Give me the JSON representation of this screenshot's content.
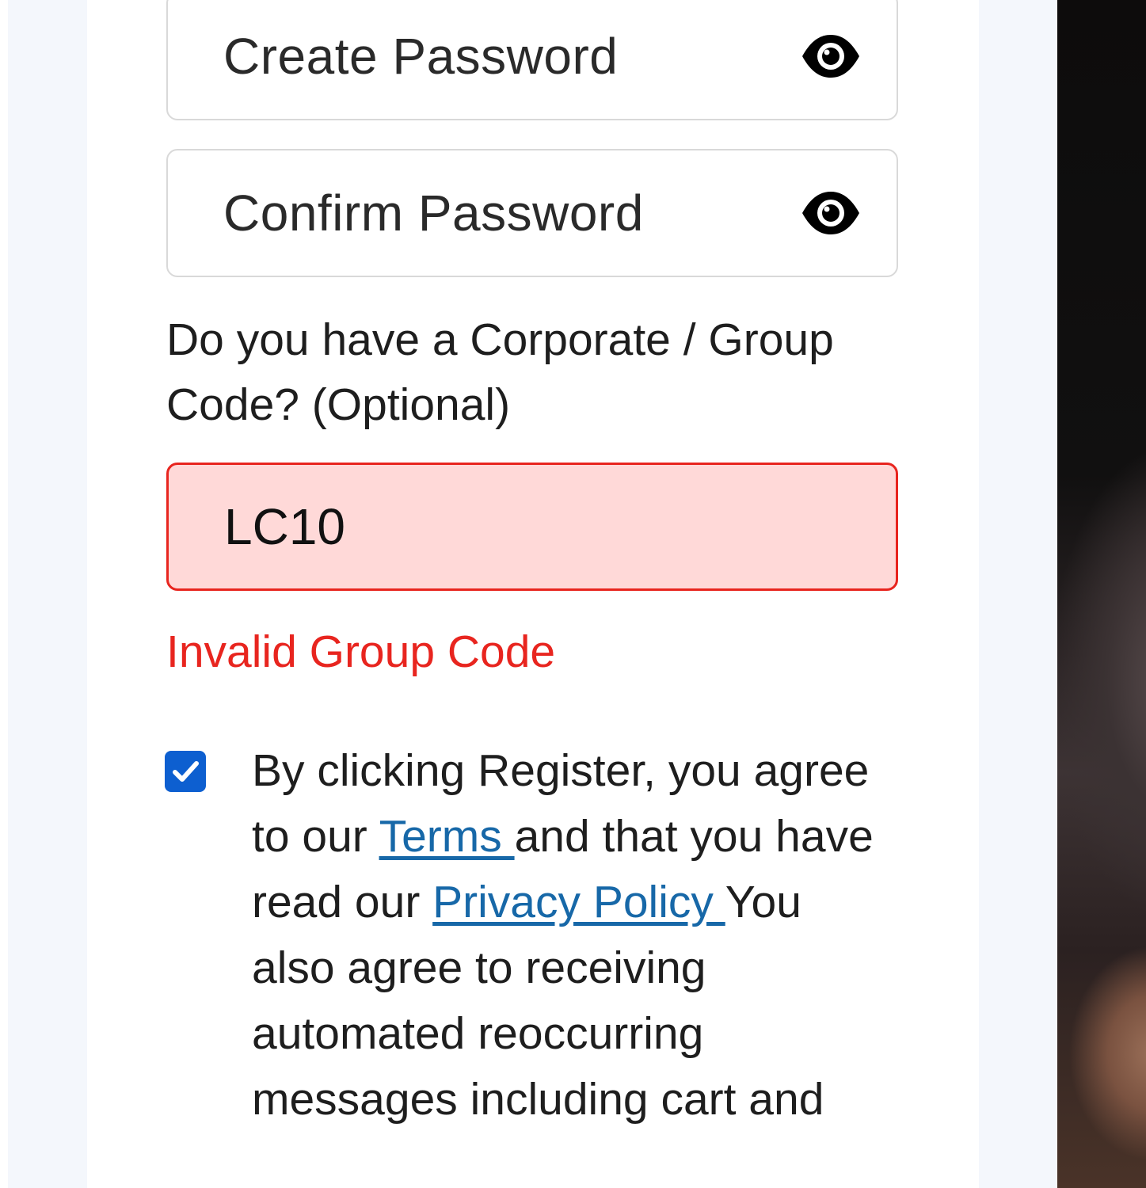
{
  "form": {
    "create_password": {
      "placeholder": "Create Password",
      "toggle_icon": "eye-icon"
    },
    "confirm_password": {
      "placeholder": "Confirm Password",
      "toggle_icon": "eye-icon"
    },
    "group_code": {
      "question": "Do you have a Corporate / Group Code? (Optional)",
      "value": "LC10",
      "error": "Invalid Group Code",
      "error_color": "#e8251f",
      "error_background": "#ffd9d8"
    },
    "consent": {
      "checked": true,
      "checkbox_color": "#0d5fd0",
      "text_part1": "By clicking Register, you agree to our ",
      "terms_link": "Terms ",
      "text_part2": "and that you have read our ",
      "privacy_link": "Privacy Policy ",
      "text_part3": "You also agree to receiving automated reoccurring messages including cart and",
      "link_color": "#1768a8"
    }
  }
}
